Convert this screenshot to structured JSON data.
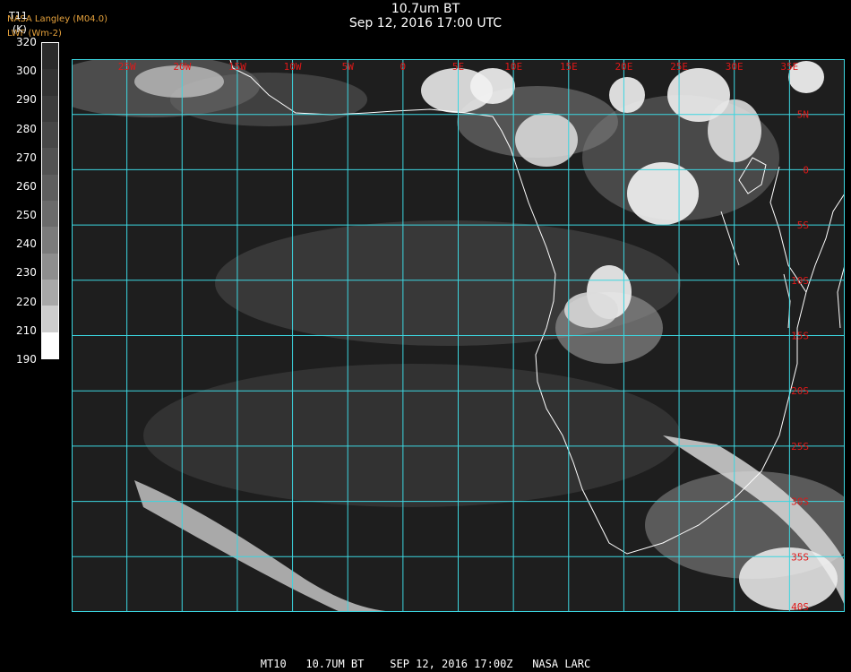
{
  "header": {
    "title": "10.7um BT",
    "subtitle": "Sep 12, 2016 17:00 UTC",
    "source_line_1": "NASA Langley (M04.0)",
    "source_line_2": "LWF (Wm-2)"
  },
  "colorbar": {
    "label": "T11",
    "unit": "(K)",
    "ticks": [
      "320",
      "300",
      "290",
      "280",
      "270",
      "260",
      "250",
      "240",
      "230",
      "220",
      "210",
      "190"
    ],
    "tick_values": [
      320,
      300,
      290,
      280,
      270,
      260,
      250,
      240,
      230,
      220,
      210,
      190
    ],
    "segment_colors": [
      "#2a2a2a",
      "#323232",
      "#3c3c3c",
      "#474747",
      "#525252",
      "#5e5e5e",
      "#6b6b6b",
      "#7b7b7b",
      "#8e8e8e",
      "#a8a8a8",
      "#cdcdcd",
      "#ffffff"
    ]
  },
  "map": {
    "projection": "geostationary-like lat/lon grid",
    "longitude_labels": [
      "25W",
      "20W",
      "15W",
      "10W",
      "5W",
      "0",
      "5E",
      "10E",
      "15E",
      "20E",
      "25E",
      "30E",
      "35E"
    ],
    "longitude_values": [
      -25,
      -20,
      -15,
      -10,
      -5,
      0,
      5,
      10,
      15,
      20,
      25,
      30,
      35
    ],
    "latitude_labels": [
      "5N",
      "0",
      "5S",
      "10S",
      "15S",
      "20S",
      "25S",
      "30S",
      "35S",
      "40S"
    ],
    "latitude_values": [
      5,
      0,
      -5,
      -10,
      -15,
      -20,
      -25,
      -30,
      -35,
      -40
    ],
    "lon_range": [
      -30,
      40
    ],
    "lat_range": [
      10,
      -40
    ],
    "colors": {
      "background": "#1e1e1e",
      "gridline": "#3cd6e0",
      "coastline": "#ffffff",
      "grid_label": "#e01818"
    }
  },
  "footer": {
    "text": "MT10   10.7UM BT    SEP 12, 2016 17:00Z   NASA LARC"
  }
}
